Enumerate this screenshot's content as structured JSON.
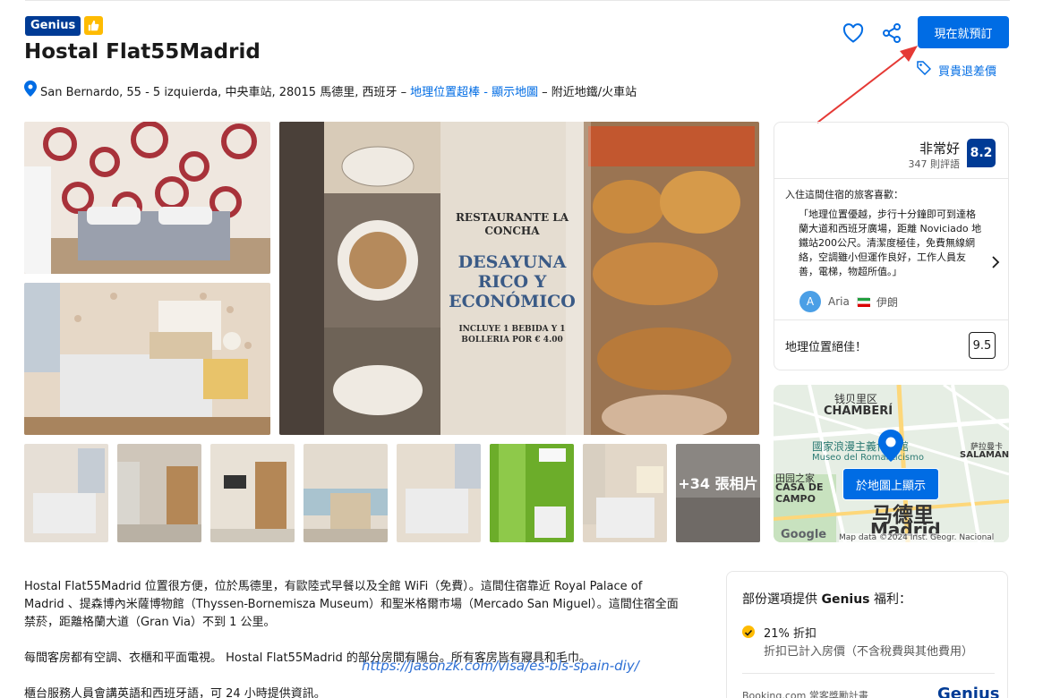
{
  "header": {
    "genius_badge": "Genius",
    "title": "Hostal Flat55Madrid",
    "address": "San Bernardo, 55 - 5 izquierda, 中央車站, 28015 馬德里, 西班牙 –",
    "location_link": "地理位置超棒 - 顯示地圖",
    "address_suffix": "– 附近地鐵/火車站",
    "reserve_button": "現在就預訂",
    "price_match": "買貴退差價"
  },
  "gallery": {
    "menu_text": {
      "restaurant": "RESTAURANTE LA CONCHA",
      "headline": "DESAYUNA RICO Y ECONÓMICO",
      "offer": "INCLUYE 1 BEBIDA Y 1 BOLLERIA POR € 4.00"
    },
    "more_photos": "+34 張相片"
  },
  "review_card": {
    "rating_word": "非常好",
    "review_count": "347 則評語",
    "score": "8.2",
    "guests_liked": "入住這間住宿的旅客喜歡：",
    "quote": "「地理位置優越，步行十分鐘即可到達格蘭大道和西班牙廣場，距離 Noviciado 地鐵站200公尺。清潔度極佳，免費無線網絡，空調雖小但運作良好，工作人員友善，電梯，物超所值。」",
    "reviewer_initial": "A",
    "reviewer_name": "Aria",
    "reviewer_country": "伊朗",
    "location_label": "地理位置絕佳！",
    "location_score": "9.5"
  },
  "map": {
    "label_district": "钱贝里区",
    "label_chamberi": "CHAMBERÍ",
    "label_museum_cn": "國家浪漫主義博物館",
    "label_museum_es": "Museo del Romanticismo",
    "label_salamanca_cn": "萨拉曼卡",
    "label_salamanca": "SALAMANCA",
    "label_campo_cn": "田园之家",
    "label_campo": "CASA DE CAMPO",
    "label_madrid_cn": "马德里",
    "label_madrid": "Madrid",
    "google": "Google",
    "copyright": "Map data ©2024 Inst. Geogr. Nacional",
    "show_on_map": "於地圖上顯示"
  },
  "description": {
    "p1": "Hostal Flat55Madrid 位置很方便，位於馬德里，有歐陸式早餐以及全館 WiFi（免費）。這間住宿靠近 Royal Palace of Madrid 、提森博內米薩博物館（Thyssen-Bornemisza Museum）和聖米格爾市場（Mercado San Miguel）。這間住宿全面禁菸，距離格蘭大道（Gran Via）不到 1 公里。",
    "p2": "每間客房都有空調、衣櫃和平面電視。 Hostal Flat55Madrid 的部分房間有陽台。所有客房皆有寢具和毛巾。",
    "p3": "櫃台服務人員會講英語和西班牙語，可 24 小時提供資訊。"
  },
  "watermark": "https://jasonzk.com/visa/es-bls-spain-diy/",
  "genius_box": {
    "title_prefix": "部份選項提供 ",
    "title_bold": "Genius",
    "title_suffix": " 福利：",
    "item": "21% 折扣",
    "item_sub": "折扣已計入房價（不含稅費與其他費用）",
    "footer": "Booking.com 常客獎勵計畫",
    "logo": "Genius"
  },
  "colors": {
    "brand_blue": "#003b95",
    "link_blue": "#006ce4",
    "genius_yellow": "#febb02",
    "annotation_red": "#e53935"
  }
}
